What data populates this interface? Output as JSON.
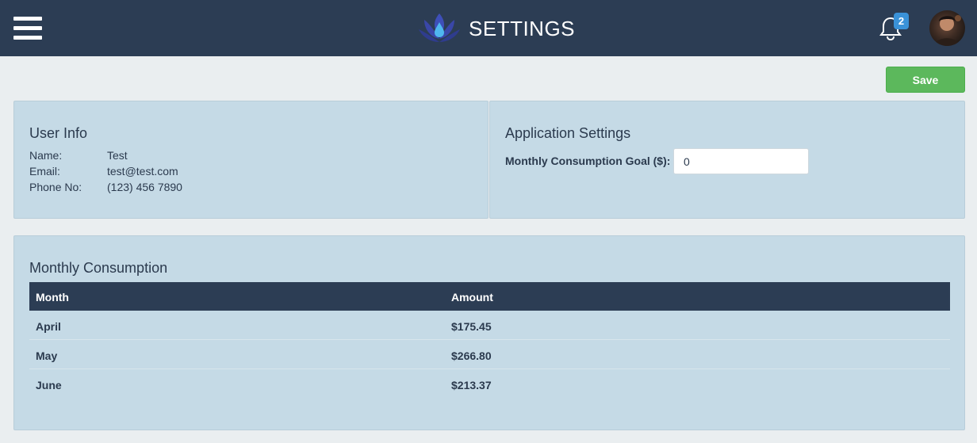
{
  "header": {
    "title": "SETTINGS",
    "menu_icon": "hamburger-menu-icon",
    "logo_icon": "lotus-drop-logo",
    "notification_icon": "bell-icon",
    "notification_count": "2",
    "avatar": "user-avatar"
  },
  "toolbar": {
    "save_label": "Save"
  },
  "user_info": {
    "title": "User Info",
    "rows": [
      {
        "label": "Name:",
        "value": "Test"
      },
      {
        "label": "Email:",
        "value": "test@test.com"
      },
      {
        "label": "Phone No:",
        "value": "(123) 456 7890"
      }
    ]
  },
  "app_settings": {
    "title": "Application Settings",
    "goal_label": "Monthly Consumption Goal ($):",
    "goal_value": "0"
  },
  "consumption": {
    "title": "Monthly Consumption",
    "columns": [
      "Month",
      "Amount"
    ],
    "rows": [
      {
        "month": "April",
        "amount": "$175.45"
      },
      {
        "month": "May",
        "amount": "$266.80"
      },
      {
        "month": "June",
        "amount": "$213.37"
      }
    ]
  },
  "colors": {
    "header_bg": "#2c3d54",
    "page_bg": "#eaeef0",
    "panel_bg": "#c5dae6",
    "save_green": "#5cb85c",
    "badge_blue": "#3a92d8"
  }
}
